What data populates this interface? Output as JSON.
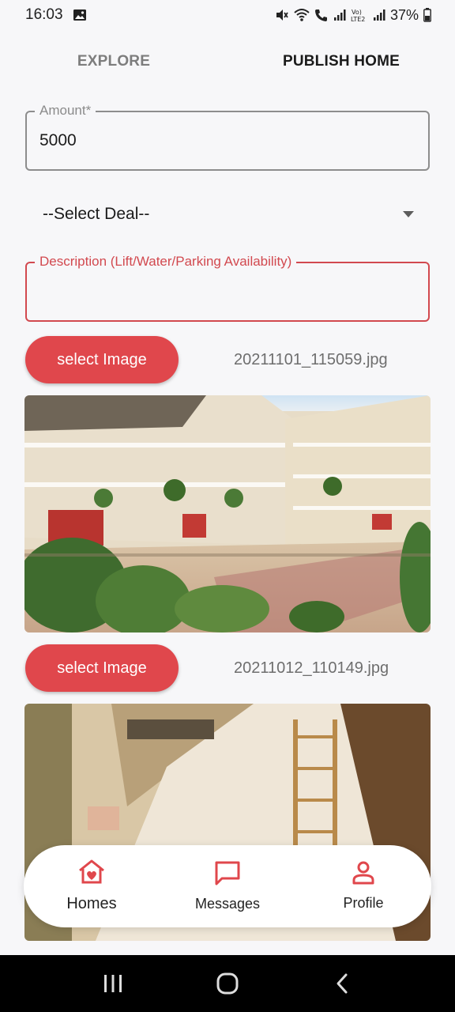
{
  "status_bar": {
    "time": "16:03",
    "battery": "37%"
  },
  "tabs": [
    {
      "label": "EXPLORE",
      "active": false
    },
    {
      "label": "PUBLISH HOME",
      "active": true
    }
  ],
  "form": {
    "amount_label": "Amount*",
    "amount_value": "5000",
    "deal_selected": "--Select Deal--",
    "description_label": "Description (Lift/Water/Parking Availability)",
    "description_value": ""
  },
  "images": [
    {
      "button_label": "select Image",
      "file_name": "20211101_115059.jpg"
    },
    {
      "button_label": "select Image",
      "file_name": "20211012_110149.jpg"
    }
  ],
  "bottom_nav": [
    {
      "label": "Homes",
      "icon": "home-heart-icon",
      "active": true
    },
    {
      "label": "Messages",
      "icon": "chat-icon",
      "active": false
    },
    {
      "label": "Profile",
      "icon": "person-icon",
      "active": false
    }
  ],
  "colors": {
    "accent": "#e0474c",
    "error_border": "#d2494f"
  }
}
